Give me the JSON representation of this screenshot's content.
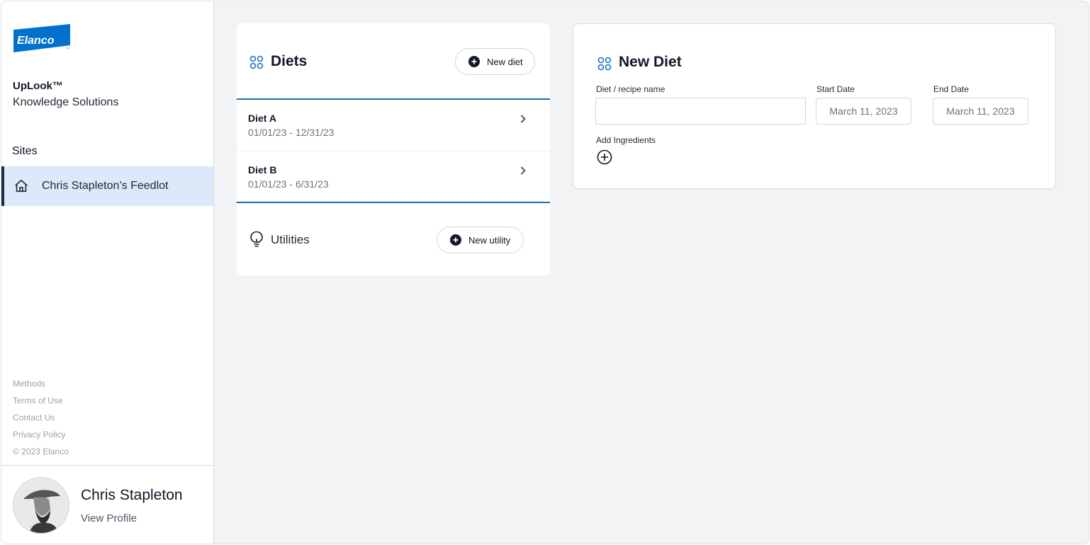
{
  "sidebar": {
    "logo_text": "Elanco",
    "logo_tm": "™",
    "brand_title": "UpLook™",
    "brand_subtitle": "Knowledge Solutions",
    "sites_label": "Sites",
    "sites": [
      {
        "label": "Chris Stapleton’s Feedlot",
        "icon": "home-icon",
        "active": true
      }
    ],
    "footer_links": [
      "Methods",
      "Terms of Use",
      "Contact Us",
      "Privacy Policy"
    ],
    "copyright": "© 2023 Elanco",
    "profile": {
      "name": "Chris Stapleton",
      "link_label": "View Profile"
    }
  },
  "diets_panel": {
    "title": "Diets",
    "icon": "grid-icon",
    "new_button_label": "New diet",
    "items": [
      {
        "name": "Diet A",
        "dates": "01/01/23 - 12/31/23"
      },
      {
        "name": "Diet B",
        "dates": "01/01/23 - 6/31/23"
      }
    ],
    "utilities": {
      "label": "Utilities",
      "icon": "lightbulb-icon",
      "new_button_label": "New utility"
    }
  },
  "new_diet_form": {
    "title": "New Diet",
    "icon": "grid-icon",
    "name_label": "Diet / recipe name",
    "name_value": "",
    "start_date_label": "Start Date",
    "start_date_value": "March 11, 2023",
    "end_date_label": "End Date",
    "end_date_value": "March 11, 2023",
    "add_ingredients_label": "Add Ingredients"
  },
  "colors": {
    "accent_blue": "#1a6ea8",
    "logo_blue": "#0072ce",
    "active_site_bg": "#dbe9fb",
    "page_bg": "#f2f3f5"
  }
}
